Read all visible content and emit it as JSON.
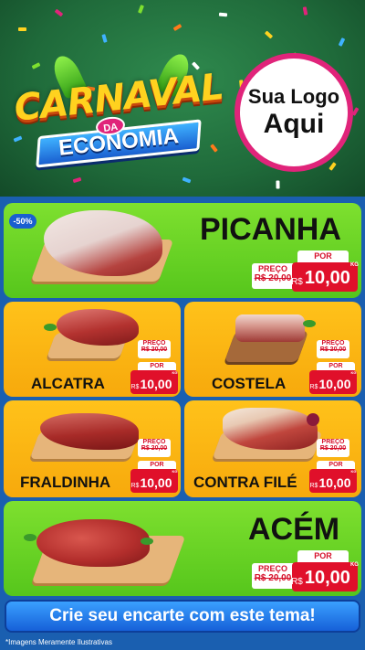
{
  "header": {
    "campaign_top": "CARNAVAL",
    "campaign_da": "DA",
    "campaign_bottom": "ECONOMIA",
    "logo_line1": "Sua Logo",
    "logo_line2": "Aqui"
  },
  "discount_badge": "-50%",
  "price_labels": {
    "preco": "PREÇO",
    "por": "POR",
    "currency": "R$",
    "unit": "KG"
  },
  "products": [
    {
      "name": "PICANHA",
      "old_price": "R$ 20,00",
      "new_price": "10,00"
    },
    {
      "name": "ALCATRA",
      "old_price": "R$ 20,00",
      "new_price": "10,00"
    },
    {
      "name": "COSTELA",
      "old_price": "R$ 20,00",
      "new_price": "10,00"
    },
    {
      "name": "FRALDINHA",
      "old_price": "R$ 20,00",
      "new_price": "10,00"
    },
    {
      "name": "CONTRA FILÉ",
      "old_price": "R$ 20,00",
      "new_price": "10,00"
    },
    {
      "name": "ACÉM",
      "old_price": "R$ 20,00",
      "new_price": "10,00"
    }
  ],
  "cta": "Crie seu encarte com este tema!",
  "footnote": "*Imagens Meramente Ilustrativas",
  "colors": {
    "green": "#6fd628",
    "yellow": "#fbb813",
    "blue": "#1a5fb0",
    "red": "#e0102a",
    "pink": "#e0247a"
  }
}
